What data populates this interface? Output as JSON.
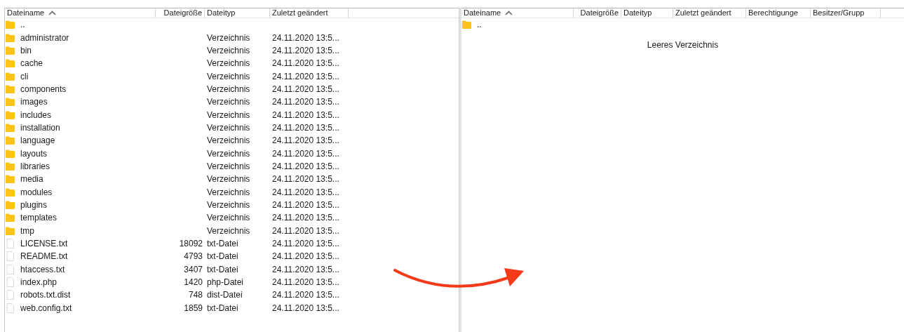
{
  "local": {
    "columns": [
      {
        "label": "Dateiname",
        "sorted": true
      },
      {
        "label": "Dateigröße",
        "sorted": false
      },
      {
        "label": "Dateityp",
        "sorted": false
      },
      {
        "label": "Zuletzt geändert",
        "sorted": false
      }
    ],
    "rows": [
      {
        "kind": "folder",
        "name": ".."
      },
      {
        "kind": "folder",
        "name": "administrator",
        "type": "Verzeichnis",
        "modified": "24.11.2020 13:5..."
      },
      {
        "kind": "folder",
        "name": "bin",
        "type": "Verzeichnis",
        "modified": "24.11.2020 13:5..."
      },
      {
        "kind": "folder",
        "name": "cache",
        "type": "Verzeichnis",
        "modified": "24.11.2020 13:5..."
      },
      {
        "kind": "folder",
        "name": "cli",
        "type": "Verzeichnis",
        "modified": "24.11.2020 13:5..."
      },
      {
        "kind": "folder",
        "name": "components",
        "type": "Verzeichnis",
        "modified": "24.11.2020 13:5..."
      },
      {
        "kind": "folder",
        "name": "images",
        "type": "Verzeichnis",
        "modified": "24.11.2020 13:5..."
      },
      {
        "kind": "folder",
        "name": "includes",
        "type": "Verzeichnis",
        "modified": "24.11.2020 13:5..."
      },
      {
        "kind": "folder",
        "name": "installation",
        "type": "Verzeichnis",
        "modified": "24.11.2020 13:5..."
      },
      {
        "kind": "folder",
        "name": "language",
        "type": "Verzeichnis",
        "modified": "24.11.2020 13:5..."
      },
      {
        "kind": "folder",
        "name": "layouts",
        "type": "Verzeichnis",
        "modified": "24.11.2020 13:5..."
      },
      {
        "kind": "folder",
        "name": "libraries",
        "type": "Verzeichnis",
        "modified": "24.11.2020 13:5..."
      },
      {
        "kind": "folder",
        "name": "media",
        "type": "Verzeichnis",
        "modified": "24.11.2020 13:5..."
      },
      {
        "kind": "folder",
        "name": "modules",
        "type": "Verzeichnis",
        "modified": "24.11.2020 13:5..."
      },
      {
        "kind": "folder",
        "name": "plugins",
        "type": "Verzeichnis",
        "modified": "24.11.2020 13:5..."
      },
      {
        "kind": "folder",
        "name": "templates",
        "type": "Verzeichnis",
        "modified": "24.11.2020 13:5..."
      },
      {
        "kind": "folder",
        "name": "tmp",
        "type": "Verzeichnis",
        "modified": "24.11.2020 13:5..."
      },
      {
        "kind": "file",
        "name": "LICENSE.txt",
        "size": "18092",
        "type": "txt-Datei",
        "modified": "24.11.2020 13:5..."
      },
      {
        "kind": "file",
        "name": "README.txt",
        "size": "4793",
        "type": "txt-Datei",
        "modified": "24.11.2020 13:5..."
      },
      {
        "kind": "file",
        "name": "htaccess.txt",
        "size": "3407",
        "type": "txt-Datei",
        "modified": "24.11.2020 13:5..."
      },
      {
        "kind": "file",
        "name": "index.php",
        "size": "1420",
        "type": "php-Datei",
        "modified": "24.11.2020 13:5..."
      },
      {
        "kind": "file",
        "name": "robots.txt.dist",
        "size": "748",
        "type": "dist-Datei",
        "modified": "24.11.2020 13:5..."
      },
      {
        "kind": "file",
        "name": "web.config.txt",
        "size": "1859",
        "type": "txt-Datei",
        "modified": "24.11.2020 13:5..."
      }
    ]
  },
  "remote": {
    "columns": [
      {
        "label": "Dateiname",
        "sorted": true
      },
      {
        "label": "Dateigröße",
        "sorted": false
      },
      {
        "label": "Dateityp",
        "sorted": false
      },
      {
        "label": "Zuletzt geändert",
        "sorted": false
      },
      {
        "label": "Berechtigunge",
        "sorted": false
      },
      {
        "label": "Besitzer/Grupp",
        "sorted": false
      }
    ],
    "rows": [
      {
        "kind": "folder",
        "name": ".."
      }
    ],
    "empty_message": "Leeres Verzeichnis"
  }
}
